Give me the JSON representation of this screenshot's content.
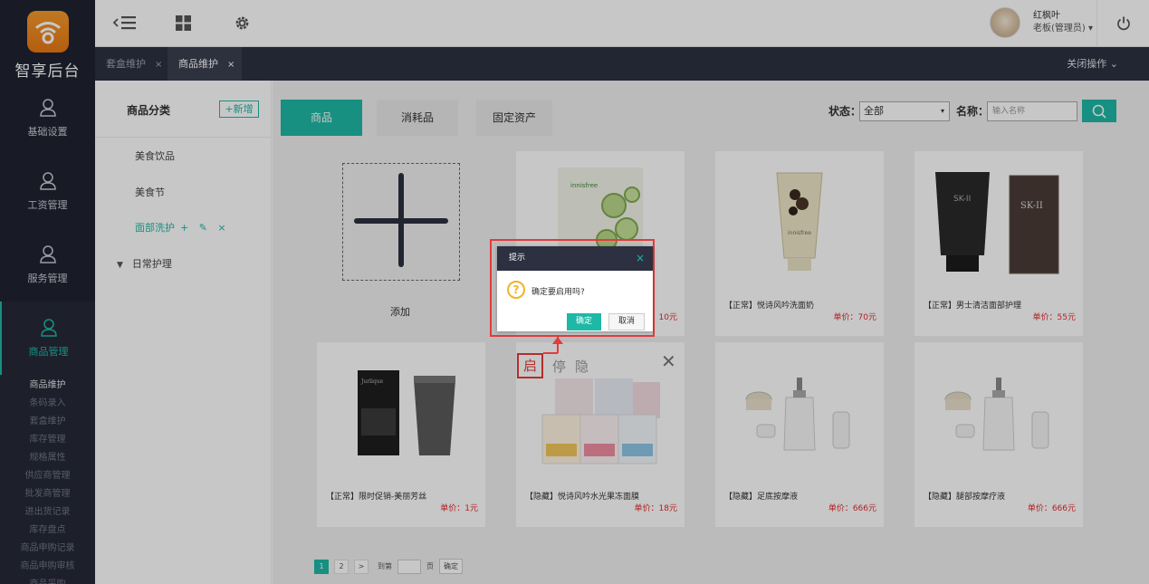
{
  "brand": {
    "name": "智享后台"
  },
  "sidebar": {
    "items": [
      {
        "label": "基础设置",
        "icon": "user-icon"
      },
      {
        "label": "工资管理",
        "icon": "user-icon"
      },
      {
        "label": "服务管理",
        "icon": "user-icon"
      },
      {
        "label": "商品管理",
        "icon": "user-icon",
        "active": true
      }
    ],
    "sub_items": [
      "商品维护",
      "条码录入",
      "套盒维护",
      "库存管理",
      "规格属性",
      "供应商管理",
      "批发商管理",
      "进出货记录",
      "库存盘点",
      "商品申购记录",
      "商品申购审核",
      "商品采购"
    ],
    "active_sub": "商品维护"
  },
  "topbar": {
    "icons": [
      "collapse-menu-icon",
      "grid-icon",
      "gear-icon",
      "power-icon"
    ],
    "user": {
      "name": "红枫叶",
      "role": "老板(管理员)",
      "caret": "▾"
    }
  },
  "page_tabs": [
    {
      "label": "套盒维护",
      "close": "×"
    },
    {
      "label": "商品维护",
      "close": "×",
      "active": true
    }
  ],
  "close_ops": "关闭操作",
  "close_ops_caret": "⌄",
  "categories": {
    "title": "商品分类",
    "add_label": "+新增",
    "items": [
      {
        "label": "美食饮品"
      },
      {
        "label": "美食节"
      },
      {
        "label": "面部洗护",
        "tools": "+ ✎ ×",
        "active": true
      },
      {
        "label": "日常护理",
        "expander": "▼"
      }
    ]
  },
  "type_tabs": [
    {
      "label": "商品",
      "active": true
    },
    {
      "label": "消耗品"
    },
    {
      "label": "固定资产"
    }
  ],
  "filters": {
    "status_label": "状态：",
    "status_value": "全部",
    "select_caret": "▾",
    "name_label": "名称：",
    "name_placeholder": "输入名称"
  },
  "add_card": {
    "label": "添加"
  },
  "products": [
    {
      "name": "",
      "price": "10元"
    },
    {
      "name": "【正常】悦诗风吟洗面奶",
      "price": "单价：70元"
    },
    {
      "name": "【正常】男士清洁面部护理",
      "price": "单价：55元"
    },
    {
      "name": "【正常】限时促销-美丽芳丝",
      "price": "单价：1元"
    },
    {
      "name": "【隐藏】悦诗风吟水光果冻面膜",
      "price": "单价：18元"
    },
    {
      "name": "【隐藏】足底按摩液",
      "price": "单价：666元"
    },
    {
      "name": "【隐藏】腿部按摩疗液",
      "price": "单价：666元"
    }
  ],
  "status_toggle": {
    "on": "启",
    "pause": "停",
    "hide": "隐",
    "close": "✕"
  },
  "pagination": {
    "pages": [
      "1",
      "2"
    ],
    "next": ">",
    "goto_label": "到第",
    "page_unit": "页",
    "confirm": "确定"
  },
  "dialog": {
    "title": "提示",
    "close": "×",
    "icon": "?",
    "message": "确定要启用吗?",
    "ok": "确定",
    "cancel": "取消"
  },
  "colors": {
    "accent": "#1eb8a6",
    "sidebar": "#1f2331",
    "danger": "#e33b3b",
    "price": "#e32a2a"
  }
}
